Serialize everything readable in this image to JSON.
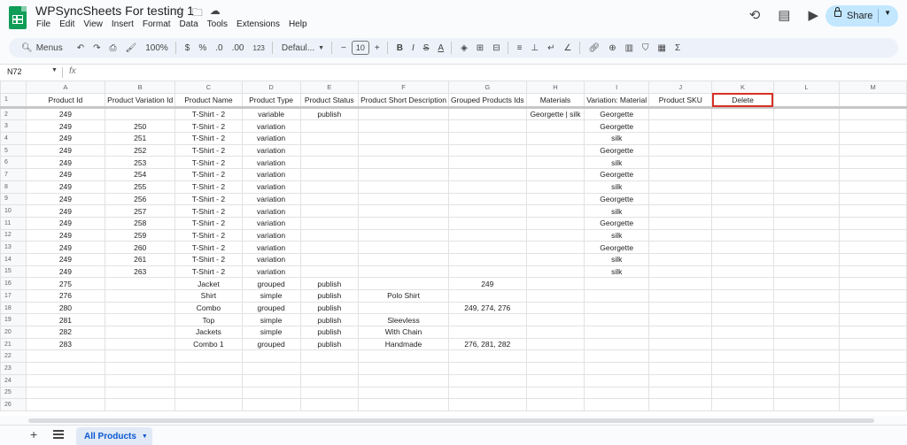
{
  "app": {
    "doc_title": "WPSyncSheets For testing 1",
    "menus": [
      "File",
      "Edit",
      "View",
      "Insert",
      "Format",
      "Data",
      "Tools",
      "Extensions",
      "Help"
    ],
    "share_label": "Share"
  },
  "toolbar": {
    "search_label": "Menus",
    "zoom": "100%",
    "percent": "%",
    "decimal_format": ".0",
    "decimal_more": ".00",
    "number_format": "123",
    "font": "Defaul...",
    "font_size": "10"
  },
  "formula_bar": {
    "name_box": "N72",
    "fx": "fx"
  },
  "columns": [
    "A",
    "B",
    "C",
    "D",
    "E",
    "F",
    "G",
    "H",
    "I",
    "J",
    "K",
    "L",
    "M"
  ],
  "rows": [
    [
      "Product Id",
      "Product Variation Id",
      "Product Name",
      "Product Type",
      "Product Status",
      "Product Short Description",
      "Grouped Products Ids",
      "Materials",
      "Variation: Material",
      "Product SKU",
      "Delete",
      "",
      ""
    ],
    [
      "249",
      "",
      "T-Shirt - 2",
      "variable",
      "publish",
      "",
      "",
      "Georgette | silk",
      "Georgette",
      "",
      "",
      "",
      ""
    ],
    [
      "249",
      "250",
      "T-Shirt - 2",
      "variation",
      "",
      "",
      "",
      "",
      "Georgette",
      "",
      "",
      "",
      ""
    ],
    [
      "249",
      "251",
      "T-Shirt - 2",
      "variation",
      "",
      "",
      "",
      "",
      "silk",
      "",
      "",
      "",
      ""
    ],
    [
      "249",
      "252",
      "T-Shirt - 2",
      "variation",
      "",
      "",
      "",
      "",
      "Georgette",
      "",
      "",
      "",
      ""
    ],
    [
      "249",
      "253",
      "T-Shirt - 2",
      "variation",
      "",
      "",
      "",
      "",
      "silk",
      "",
      "",
      "",
      ""
    ],
    [
      "249",
      "254",
      "T-Shirt - 2",
      "variation",
      "",
      "",
      "",
      "",
      "Georgette",
      "",
      "",
      "",
      ""
    ],
    [
      "249",
      "255",
      "T-Shirt - 2",
      "variation",
      "",
      "",
      "",
      "",
      "silk",
      "",
      "",
      "",
      ""
    ],
    [
      "249",
      "256",
      "T-Shirt - 2",
      "variation",
      "",
      "",
      "",
      "",
      "Georgette",
      "",
      "",
      "",
      ""
    ],
    [
      "249",
      "257",
      "T-Shirt - 2",
      "variation",
      "",
      "",
      "",
      "",
      "silk",
      "",
      "",
      "",
      ""
    ],
    [
      "249",
      "258",
      "T-Shirt - 2",
      "variation",
      "",
      "",
      "",
      "",
      "Georgette",
      "",
      "",
      "",
      ""
    ],
    [
      "249",
      "259",
      "T-Shirt - 2",
      "variation",
      "",
      "",
      "",
      "",
      "silk",
      "",
      "",
      "",
      ""
    ],
    [
      "249",
      "260",
      "T-Shirt - 2",
      "variation",
      "",
      "",
      "",
      "",
      "Georgette",
      "",
      "",
      "",
      ""
    ],
    [
      "249",
      "261",
      "T-Shirt - 2",
      "variation",
      "",
      "",
      "",
      "",
      "silk",
      "",
      "",
      "",
      ""
    ],
    [
      "249",
      "263",
      "T-Shirt - 2",
      "variation",
      "",
      "",
      "",
      "",
      "silk",
      "",
      "",
      "",
      ""
    ],
    [
      "275",
      "",
      "Jacket",
      "grouped",
      "publish",
      "",
      "249",
      "",
      "",
      "",
      "",
      "",
      ""
    ],
    [
      "276",
      "",
      "Shirt",
      "simple",
      "publish",
      "Polo Shirt",
      "",
      "",
      "",
      "",
      "",
      "",
      ""
    ],
    [
      "280",
      "",
      "Combo",
      "grouped",
      "publish",
      "",
      "249, 274, 276",
      "",
      "",
      "",
      "",
      "",
      ""
    ],
    [
      "281",
      "",
      "Top",
      "simple",
      "publish",
      "Sleevless",
      "",
      "",
      "",
      "",
      "",
      "",
      ""
    ],
    [
      "282",
      "",
      "Jackets",
      "simple",
      "publish",
      "With Chain",
      "",
      "",
      "",
      "",
      "",
      "",
      ""
    ],
    [
      "283",
      "",
      "Combo 1",
      "grouped",
      "publish",
      "Handmade",
      "276, 281, 282",
      "",
      "",
      "",
      "",
      "",
      ""
    ],
    [
      "",
      "",
      "",
      "",
      "",
      "",
      "",
      "",
      "",
      "",
      "",
      "",
      ""
    ],
    [
      "",
      "",
      "",
      "",
      "",
      "",
      "",
      "",
      "",
      "",
      "",
      "",
      ""
    ],
    [
      "",
      "",
      "",
      "",
      "",
      "",
      "",
      "",
      "",
      "",
      "",
      "",
      ""
    ],
    [
      "",
      "",
      "",
      "",
      "",
      "",
      "",
      "",
      "",
      "",
      "",
      "",
      ""
    ],
    [
      "",
      "",
      "",
      "",
      "",
      "",
      "",
      "",
      "",
      "",
      "",
      "",
      ""
    ]
  ],
  "selected_cell": "K1",
  "selection_color": "#d93025",
  "sheet_tab": "All Products",
  "colors": {
    "accent": "#0b57d0",
    "share_bg": "#c2e7ff",
    "logo": "#0f9d58"
  }
}
